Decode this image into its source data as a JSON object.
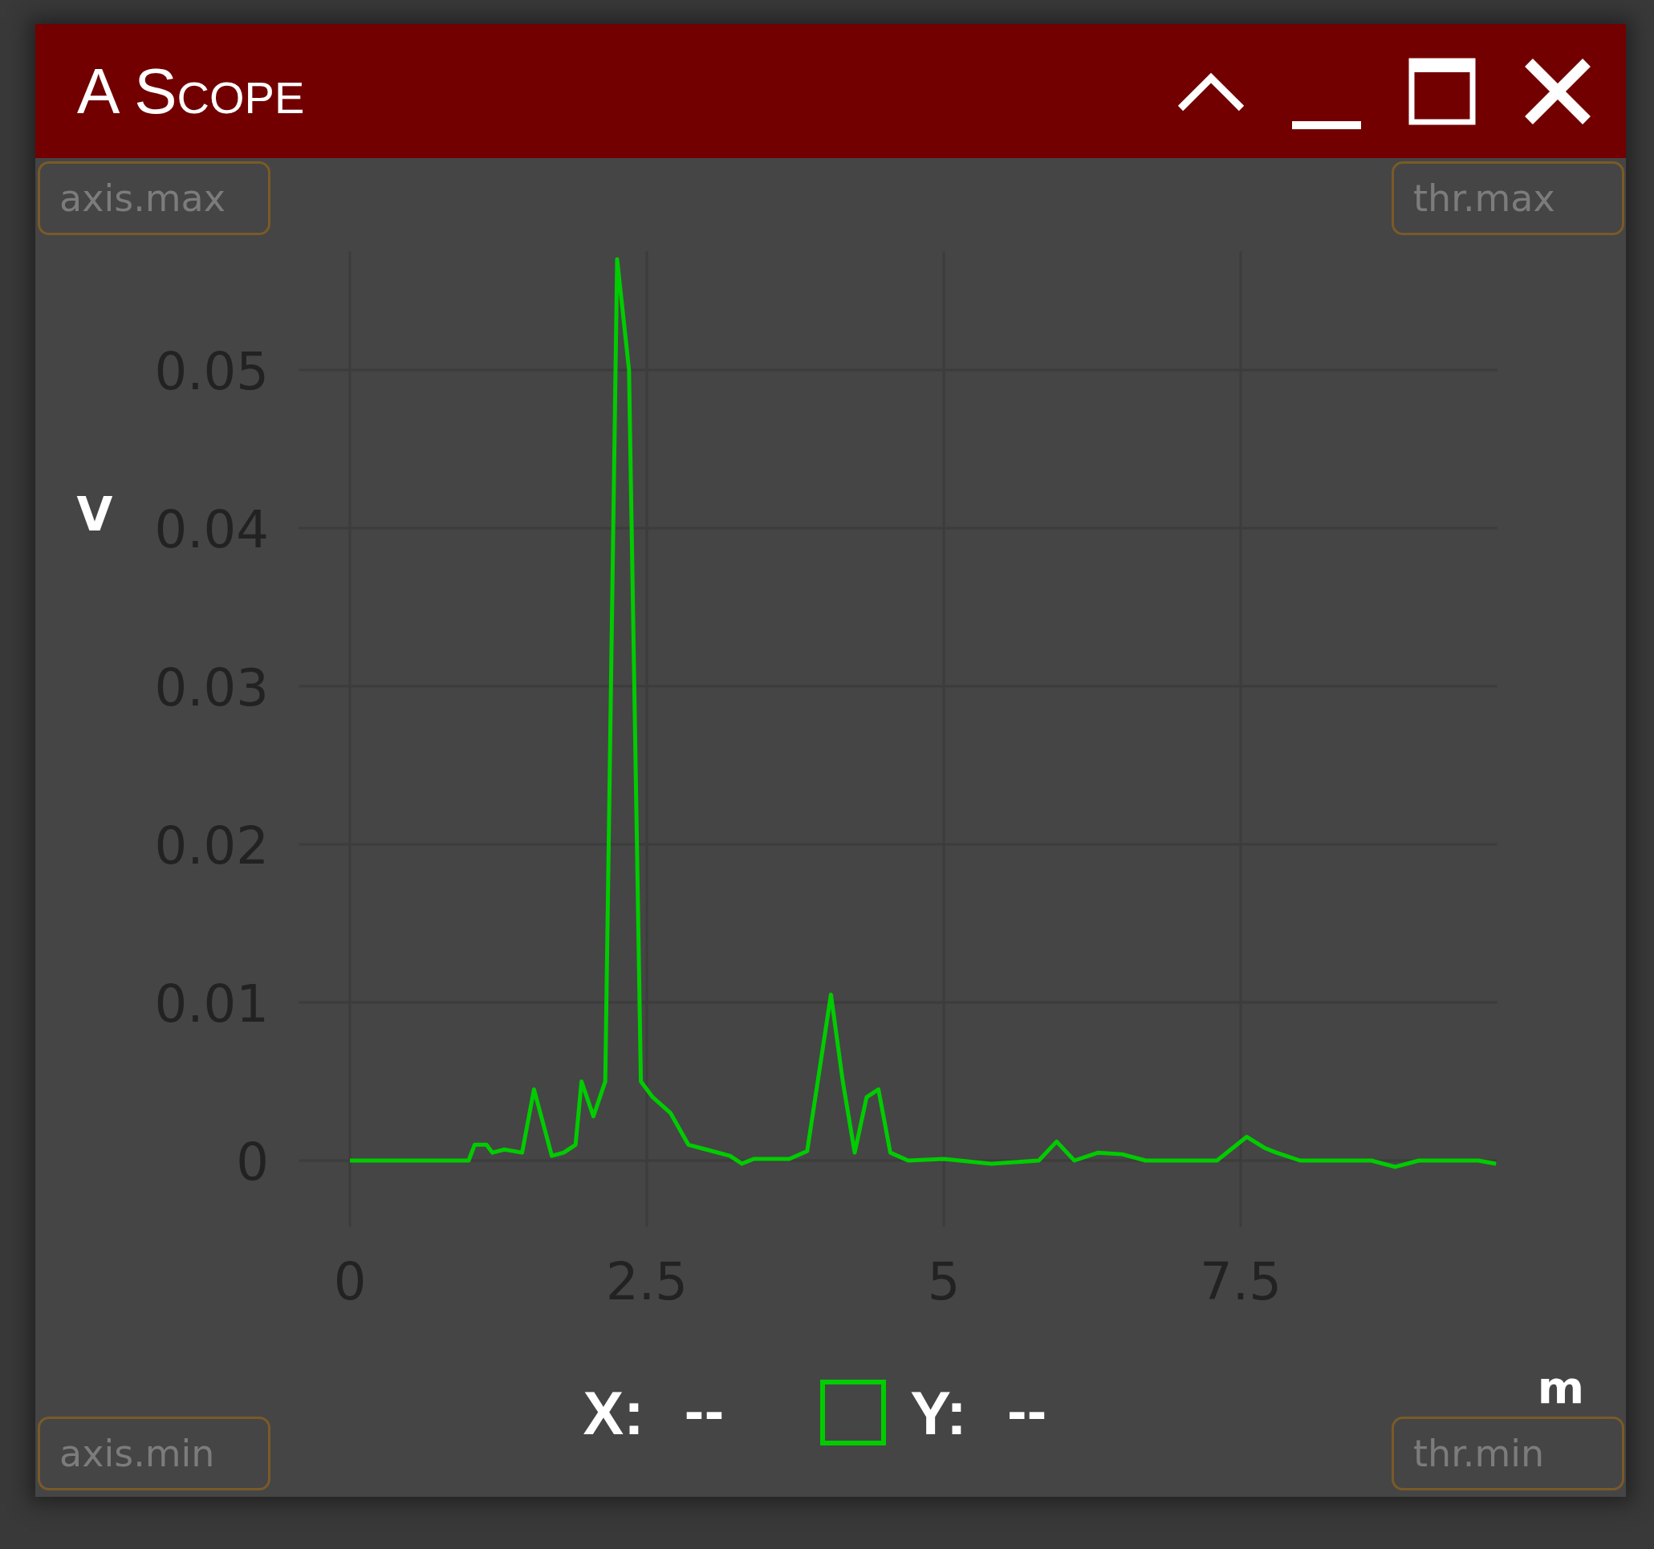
{
  "window": {
    "title": "A Scope"
  },
  "fields": {
    "top_left": {
      "placeholder": "axis.max"
    },
    "top_right": {
      "placeholder": "thr.max"
    },
    "bottom_left": {
      "placeholder": "axis.min"
    },
    "bottom_right": {
      "placeholder": "thr.min"
    }
  },
  "chart_data": {
    "type": "line",
    "xlabel": "m",
    "ylabel": "V",
    "grid": true,
    "xlim": [
      -0.43,
      9.66
    ],
    "ylim": [
      -0.0042,
      0.0575
    ],
    "x": [
      0,
      1.0,
      1.05,
      1.15,
      1.2,
      1.3,
      1.45,
      1.55,
      1.7,
      1.8,
      1.9,
      1.95,
      2.05,
      2.15,
      2.25,
      2.35,
      2.45,
      2.55,
      2.7,
      2.85,
      3.0,
      3.2,
      3.3,
      3.4,
      3.7,
      3.85,
      4.05,
      4.15,
      4.25,
      4.35,
      4.45,
      4.55,
      4.7,
      5.0,
      5.4,
      5.8,
      5.95,
      6.1,
      6.3,
      6.5,
      6.7,
      7.0,
      7.3,
      7.55,
      7.7,
      7.8,
      8.0,
      8.6,
      8.8,
      9.0,
      9.5,
      9.65
    ],
    "series": [
      {
        "color": "#00cc00",
        "values": [
          0,
          0,
          0.001,
          0.001,
          0.0005,
          0.0007,
          0.0005,
          0.0045,
          0.0003,
          0.0005,
          0.001,
          0.005,
          0.0028,
          0.005,
          0.057,
          0.05,
          0.005,
          0.004,
          0.003,
          0.001,
          0.0007,
          0.0003,
          -0.0002,
          0.0001,
          0.0001,
          0.0006,
          0.0105,
          0.005,
          0.0005,
          0.004,
          0.0045,
          0.0005,
          0,
          0.0001,
          -0.0002,
          0,
          0.0012,
          0,
          0.0005,
          0.0004,
          0,
          0,
          0,
          0.0015,
          0.0008,
          0.0005,
          0,
          0,
          -0.0004,
          0,
          0,
          -0.0002
        ]
      }
    ],
    "xticks": [
      {
        "value": 0,
        "label": "0"
      },
      {
        "value": 2.5,
        "label": "2.5"
      },
      {
        "value": 5,
        "label": "5"
      },
      {
        "value": 7.5,
        "label": "7.5"
      }
    ],
    "yticks": [
      {
        "value": 0,
        "label": "0"
      },
      {
        "value": 0.01,
        "label": "0.01"
      },
      {
        "value": 0.02,
        "label": "0.02"
      },
      {
        "value": 0.03,
        "label": "0.03"
      },
      {
        "value": 0.04,
        "label": "0.04"
      },
      {
        "value": 0.05,
        "label": "0.05"
      }
    ]
  },
  "legend": {
    "x_label": "X:",
    "x_value": "--",
    "y_label": "Y:",
    "y_value": "--"
  }
}
